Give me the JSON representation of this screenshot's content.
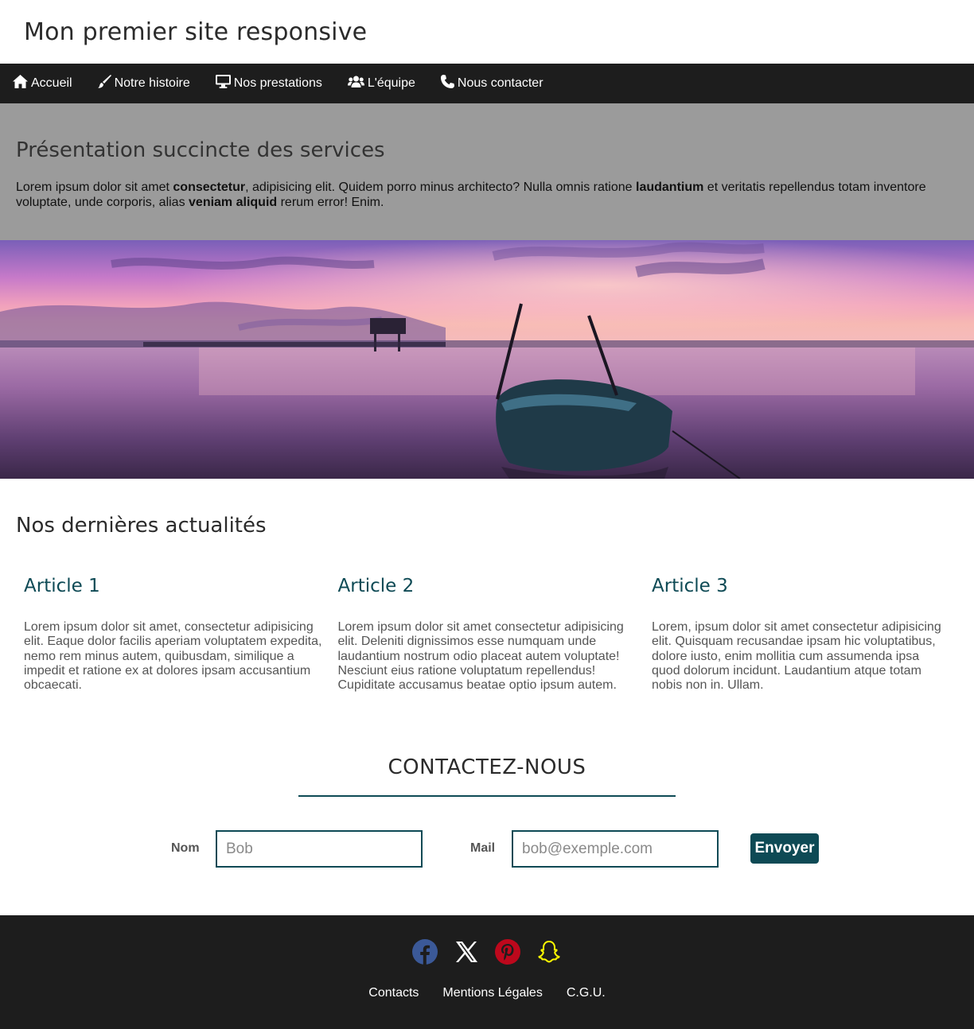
{
  "header": {
    "title": "Mon premier site responsive"
  },
  "nav": {
    "items": [
      {
        "label": "Accueil",
        "icon": "home-icon"
      },
      {
        "label": "Notre histoire",
        "icon": "brush-icon"
      },
      {
        "label": "Nos prestations",
        "icon": "desktop-icon"
      },
      {
        "label": "L'équipe",
        "icon": "users-icon"
      },
      {
        "label": "Nous contacter",
        "icon": "phone-icon"
      }
    ]
  },
  "intro": {
    "title": "Présentation succincte des services",
    "text_parts": [
      "Lorem ipsum dolor sit amet ",
      "consectetur",
      ", adipisicing elit. Quidem porro minus architecto? Nulla omnis ratione ",
      "laudantium",
      " et veritatis repellendus totam inventore voluptate, unde corporis, alias ",
      "veniam aliquid",
      " rerum error! Enim."
    ]
  },
  "hero": {
    "alt": "boat-at-sunset-image"
  },
  "news": {
    "title": "Nos dernières actualités",
    "articles": [
      {
        "title": "Article 1",
        "text": "Lorem ipsum dolor sit amet, consectetur adipisicing elit. Eaque dolor facilis aperiam voluptatem expedita, nemo rem minus autem, quibusdam, similique a impedit et ratione ex at dolores ipsam accusantium obcaecati."
      },
      {
        "title": "Article 2",
        "text": "Lorem ipsum dolor sit amet consectetur adipisicing elit. Deleniti dignissimos esse numquam unde laudantium nostrum odio placeat autem voluptate! Nesciunt eius ratione voluptatum repellendus! Cupiditate accusamus beatae optio ipsum autem."
      },
      {
        "title": "Article 3",
        "text": "Lorem, ipsum dolor sit amet consectetur adipisicing elit. Quisquam recusandae ipsam hic voluptatibus, dolore iusto, enim mollitia cum assumenda ipsa quod dolorum incidunt. Laudantium atque totam nobis non in. Ullam."
      }
    ]
  },
  "contact": {
    "title": "CONTACTEZ-NOUS",
    "name_label": "Nom",
    "name_placeholder": "Bob",
    "mail_label": "Mail",
    "mail_placeholder": "bob@exemple.com",
    "submit_label": "Envoyer"
  },
  "footer": {
    "socials": [
      {
        "icon": "facebook-icon",
        "color": "#3b5998"
      },
      {
        "icon": "x-twitter-icon",
        "color": "#ffffff"
      },
      {
        "icon": "pinterest-icon",
        "color": "#bd081c"
      },
      {
        "icon": "snapchat-icon",
        "color": "#fffc00"
      }
    ],
    "links": [
      "Contacts",
      "Mentions Légales",
      "C.G.U."
    ]
  },
  "colors": {
    "accent": "#0e4a55",
    "nav_bg": "#1d1d1d",
    "intro_bg": "#9b9b9b",
    "footer_bg": "#1d1d1d"
  }
}
